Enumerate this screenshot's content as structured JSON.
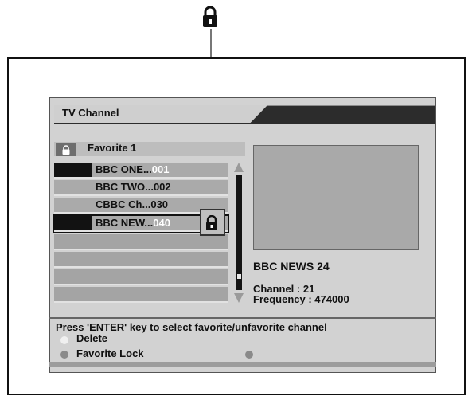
{
  "window": {
    "title": "TV Channel"
  },
  "favorite_group": {
    "title": "Favorite 1",
    "icon": "lock-icon"
  },
  "channels": [
    {
      "name": "BBC ONE...",
      "number": "001",
      "number_faded": true
    },
    {
      "name": "BBC TWO...",
      "number": "002",
      "number_faded": false
    },
    {
      "name": "CBBC Ch...",
      "number": "030",
      "number_faded": false
    },
    {
      "name": "BBC NEW...",
      "number": "040",
      "number_faded": true,
      "selected": true,
      "locked": true
    }
  ],
  "channel_info": {
    "name": "BBC NEWS 24",
    "channel": "Channel : 21",
    "frequency": "Frequency : 474000"
  },
  "help": {
    "main": "Press 'ENTER' key to select favorite/unfavorite channel",
    "delete": "Delete",
    "favorite_lock": "Favorite Lock"
  },
  "colors": {
    "title_bar": "#2c2c2c",
    "panel": "#d2d2d2",
    "row": "#aaaaaa",
    "black_block": "#121212"
  }
}
